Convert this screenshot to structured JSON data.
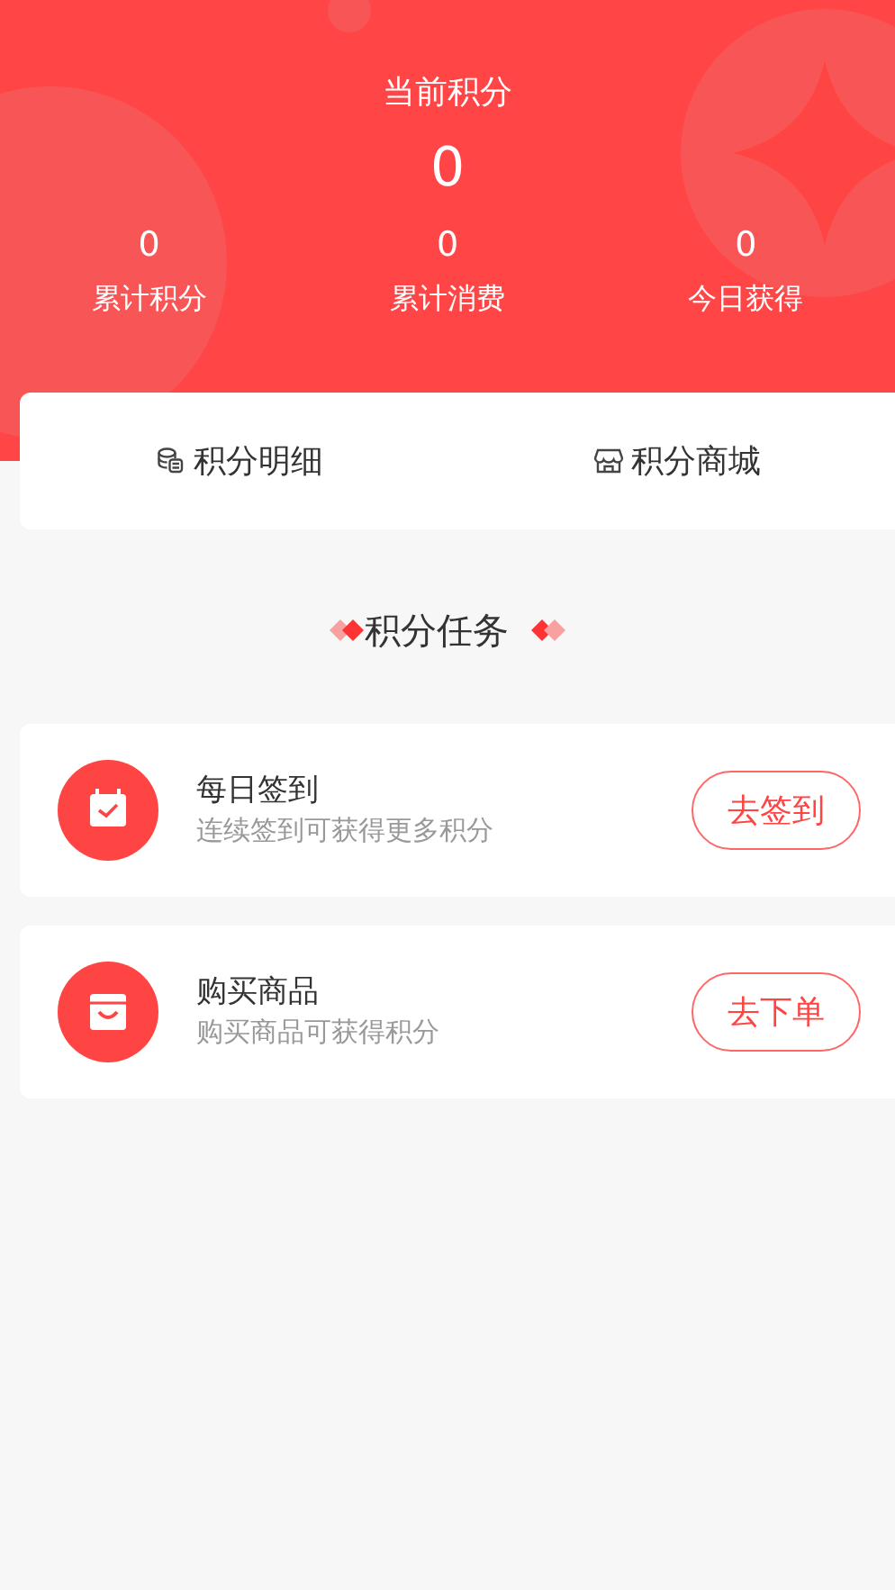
{
  "header": {
    "title": "当前积分",
    "points": "0",
    "stats": [
      {
        "value": "0",
        "label": "累计积分"
      },
      {
        "value": "0",
        "label": "累计消费"
      },
      {
        "value": "0",
        "label": "今日获得"
      }
    ]
  },
  "links": [
    {
      "kind": "coins",
      "label": "积分明细"
    },
    {
      "kind": "shop",
      "label": "积分商城"
    }
  ],
  "section_title": "积分任务",
  "tasks": [
    {
      "kind": "calendar",
      "title": "每日签到",
      "subtitle": "连续签到可获得更多积分",
      "button": "去签到"
    },
    {
      "kind": "bag",
      "title": "购买商品",
      "subtitle": "购买商品可获得积分",
      "button": "去下单"
    }
  ]
}
